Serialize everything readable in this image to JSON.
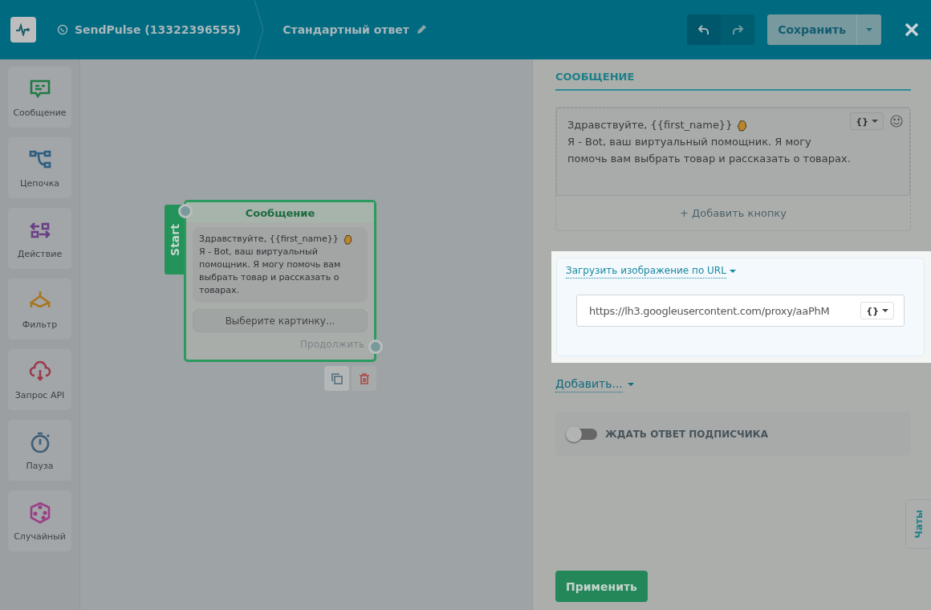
{
  "header": {
    "channel": "SendPulse (13322396555)",
    "flow_title": "Стандартный ответ",
    "save_button": "Сохранить"
  },
  "sidebar": {
    "items": [
      {
        "kind": "message",
        "label": "Сообщение"
      },
      {
        "kind": "chain",
        "label": "Цепочка"
      },
      {
        "kind": "action",
        "label": "Действие"
      },
      {
        "kind": "filter",
        "label": "Фильтр"
      },
      {
        "kind": "api",
        "label": "Запрос API"
      },
      {
        "kind": "pause",
        "label": "Пауза"
      },
      {
        "kind": "random",
        "label": "Случайный"
      }
    ]
  },
  "node": {
    "start_tab": "Start",
    "title": "Сообщение",
    "greeting": "Здравствуйте,  {{first_name}}",
    "body": "Я - Bot, ваш виртуальный помощник. Я могу помочь вам выбрать товар и рассказать о товарах.",
    "image_button": "Выберите картинку...",
    "continue": "Продолжить"
  },
  "panel": {
    "section_title": "СООБЩЕНИЕ",
    "greeting": "Здравствуйте,  {{first_name}}",
    "body_lines": [
      "Я - Bot, ваш виртуальный помощник. Я могу",
      "помочь вам выбрать товар и рассказать о товарах."
    ],
    "variable_button": "{}",
    "add_button": "+ Добавить кнопку",
    "image_source": "Загрузить изображение по URL",
    "url_value": "https://lh3.googleusercontent.com/proxy/aaPhM",
    "url_variable_button": "{}",
    "add_more": "Добавить...",
    "wait_toggle": {
      "label": "ЖДАТЬ ОТВЕТ ПОДПИСЧИКА",
      "on": false
    },
    "apply_button": "Применить",
    "chats_tab": "Чаты"
  }
}
